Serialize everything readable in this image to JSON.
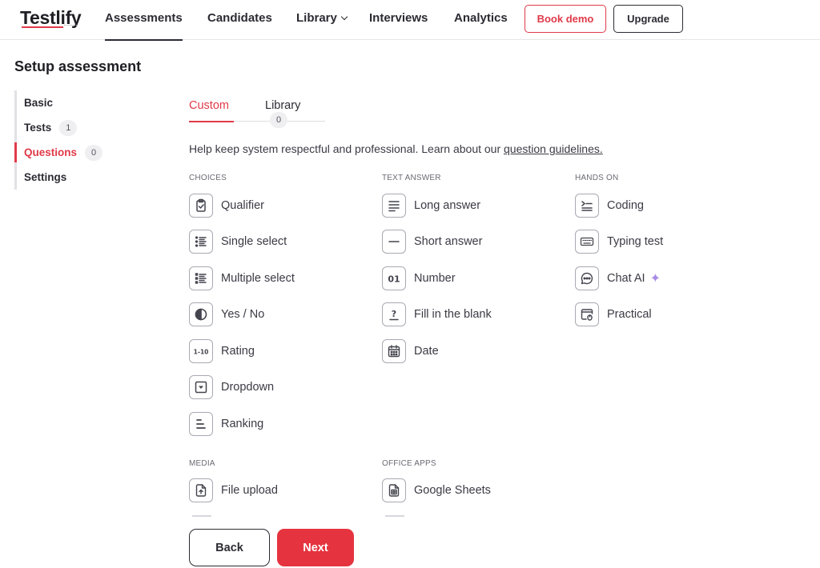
{
  "brand": {
    "logo_text": "Testlify"
  },
  "nav": {
    "items": [
      {
        "label": "Assessments"
      },
      {
        "label": "Candidates"
      },
      {
        "label": "Library"
      },
      {
        "label": "Interviews"
      },
      {
        "label": "Analytics"
      }
    ],
    "book_demo": "Book demo",
    "upgrade": "Upgrade"
  },
  "page": {
    "title": "Setup assessment"
  },
  "steps": [
    {
      "label": "Basic",
      "badge": ""
    },
    {
      "label": "Tests",
      "badge": "1"
    },
    {
      "label": "Questions",
      "badge": "0"
    },
    {
      "label": "Settings",
      "badge": ""
    }
  ],
  "tabs": {
    "custom": "Custom",
    "library": "Library",
    "library_count": "0"
  },
  "help": {
    "text": "Help keep system respectful and professional. Learn about our ",
    "link": "question guidelines."
  },
  "sections": {
    "choices": {
      "label": "CHOICES",
      "items": [
        {
          "label": "Qualifier",
          "icon": "clipboard-check-icon"
        },
        {
          "label": "Single select",
          "icon": "list-icon"
        },
        {
          "label": "Multiple select",
          "icon": "checklist-icon"
        },
        {
          "label": "Yes / No",
          "icon": "half-circle-icon"
        },
        {
          "label": "Rating",
          "icon": "rating-scale-icon"
        },
        {
          "label": "Dropdown",
          "icon": "dropdown-icon"
        },
        {
          "label": "Ranking",
          "icon": "ranking-icon"
        }
      ]
    },
    "text_answer": {
      "label": "TEXT ANSWER",
      "items": [
        {
          "label": "Long answer",
          "icon": "paragraph-icon"
        },
        {
          "label": "Short answer",
          "icon": "short-line-icon"
        },
        {
          "label": "Number",
          "icon": "number-icon"
        },
        {
          "label": "Fill in the blank",
          "icon": "question-mark-icon"
        },
        {
          "label": "Date",
          "icon": "calendar-icon"
        }
      ]
    },
    "hands_on": {
      "label": "HANDS ON",
      "items": [
        {
          "label": "Coding",
          "icon": "code-icon"
        },
        {
          "label": "Typing test",
          "icon": "keyboard-icon"
        },
        {
          "label": "Chat AI",
          "icon": "chat-bubble-icon"
        },
        {
          "label": "Practical",
          "icon": "window-pointer-icon"
        }
      ]
    },
    "media": {
      "label": "MEDIA",
      "items": [
        {
          "label": "File upload",
          "icon": "file-upload-icon"
        }
      ]
    },
    "office_apps": {
      "label": "OFFICE APPS",
      "items": [
        {
          "label": "Google Sheets",
          "icon": "spreadsheet-icon"
        }
      ]
    }
  },
  "footer": {
    "back": "Back",
    "next": "Next"
  },
  "colors": {
    "accent": "#e03a49",
    "text": "#2b2b33",
    "sparkle": "#a98be6"
  }
}
